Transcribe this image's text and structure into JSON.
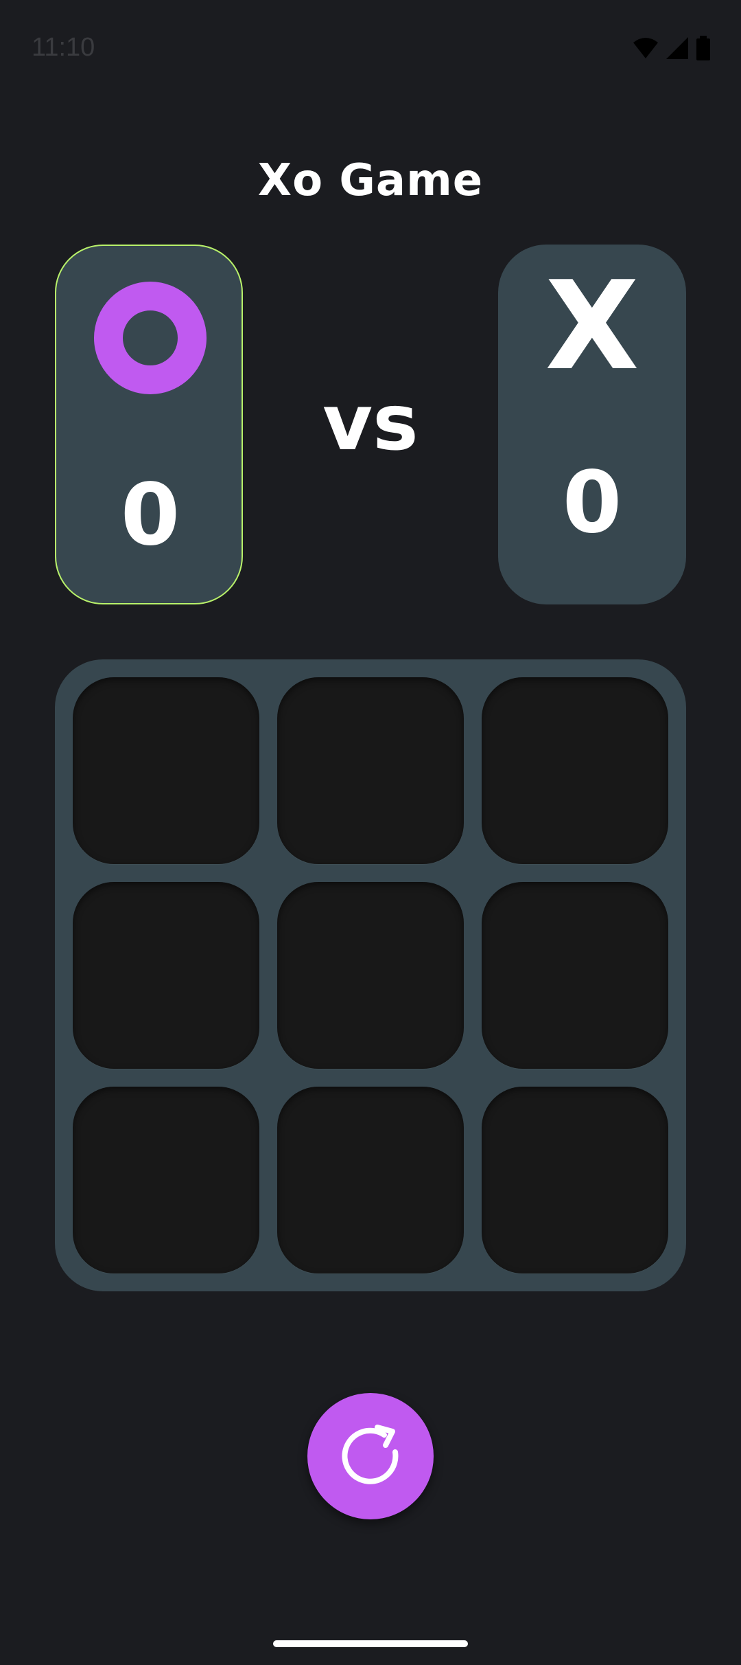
{
  "status_bar": {
    "time": "11:10",
    "icons": [
      "wifi-icon",
      "cellular-signal-icon",
      "battery-icon"
    ]
  },
  "app": {
    "title": "Xo Game"
  },
  "players": {
    "o": {
      "symbol": "O",
      "score": "0",
      "active": true,
      "color": "#c05af0"
    },
    "x": {
      "symbol": "X",
      "score": "0",
      "active": false,
      "color": "#ffffff"
    }
  },
  "versus_label": "vs",
  "board": {
    "rows": 3,
    "cols": 3,
    "cells": [
      "",
      "",
      "",
      "",
      "",
      "",
      "",
      "",
      ""
    ]
  },
  "controls": {
    "restart_icon": "restart-icon"
  },
  "colors": {
    "background": "#1b1c20",
    "panel": "#37474f",
    "cell": "#181818",
    "accent": "#c05af0",
    "active_border": "#b9f26a"
  }
}
